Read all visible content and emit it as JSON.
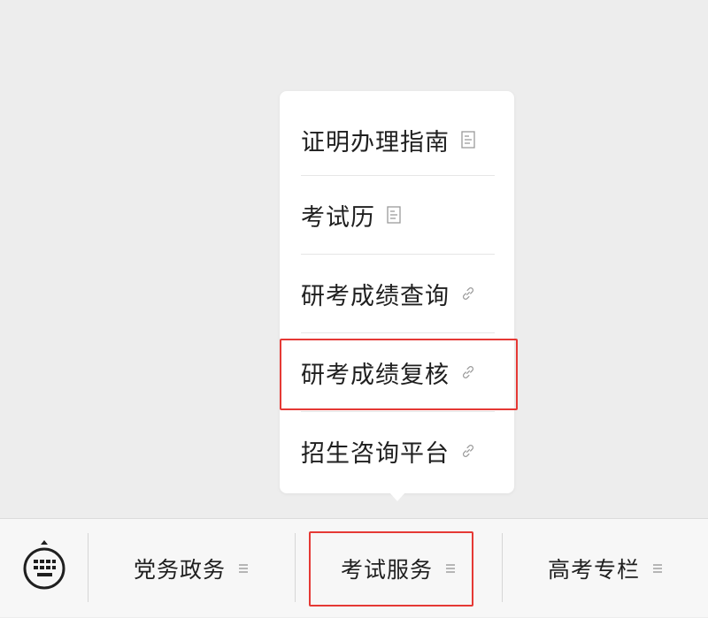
{
  "submenu": {
    "items": [
      {
        "label": "证明办理指南",
        "icon": "document-icon"
      },
      {
        "label": "考试历",
        "icon": "document-icon"
      },
      {
        "label": "研考成绩查询",
        "icon": "link-icon"
      },
      {
        "label": "研考成绩复核",
        "icon": "link-icon"
      },
      {
        "label": "招生咨询平台",
        "icon": "link-icon"
      }
    ]
  },
  "bottom_menu": {
    "keyboard_icon": "keyboard-icon",
    "tabs": [
      {
        "label": "党务政务",
        "icon": "menu-lines-icon"
      },
      {
        "label": "考试服务",
        "icon": "menu-lines-icon"
      },
      {
        "label": "高考专栏",
        "icon": "menu-lines-icon"
      }
    ]
  },
  "colors": {
    "background": "#ededed",
    "popup": "#ffffff",
    "bar": "#f7f7f7",
    "text": "#1f1f1f",
    "highlight": "#e53935",
    "icon": "#9a9a9a"
  }
}
